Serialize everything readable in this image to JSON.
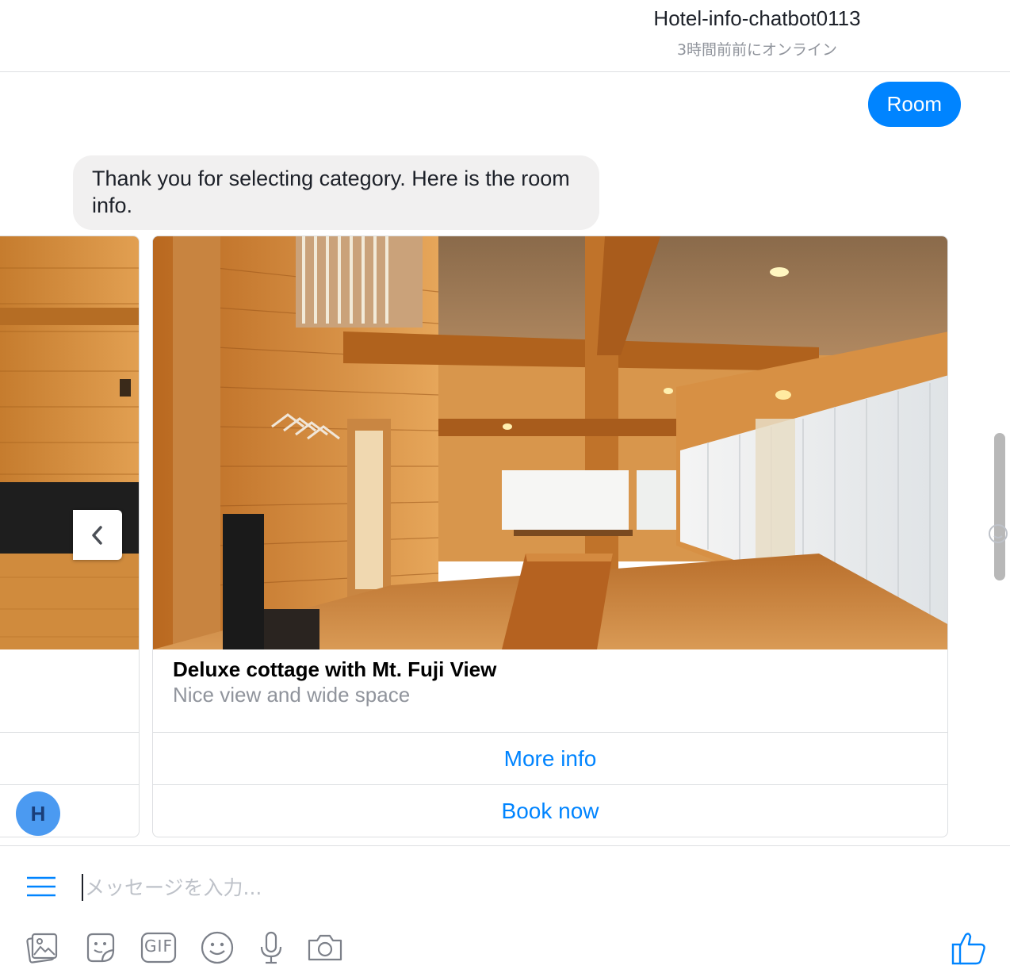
{
  "header": {
    "title": "Hotel-info-chatbot0113",
    "status": "3時間前前にオンライン"
  },
  "messages": {
    "user_message": "Room",
    "bot_message": "Thank you for selecting category. Here is the room info."
  },
  "carousel": {
    "card": {
      "title": "Deluxe cottage with Mt. Fuji View",
      "subtitle": "Nice view and wide space",
      "buttons": [
        "More info",
        "Book now"
      ]
    }
  },
  "avatar": {
    "initial": "H"
  },
  "composer": {
    "placeholder": "メッセージを入力...",
    "value": ""
  },
  "toolbar": {
    "icons": [
      "image-icon",
      "sticker-icon",
      "gif-icon",
      "emoji-icon",
      "microphone-icon",
      "camera-icon",
      "thumbs-up-icon"
    ],
    "gif_label": "GIF"
  },
  "colors": {
    "accent": "#0084ff",
    "bot_bubble": "#f1f0f0",
    "muted_text": "#90949c",
    "border": "#dddfe2"
  }
}
